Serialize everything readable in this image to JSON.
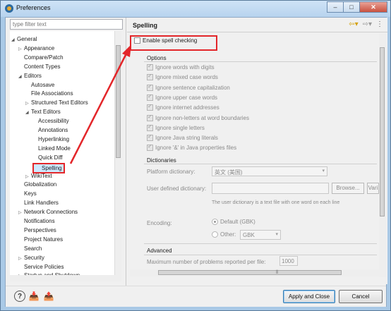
{
  "window": {
    "title": "Preferences"
  },
  "filter": {
    "placeholder": "type filter text"
  },
  "tree": [
    {
      "label": "General",
      "twisty": "open"
    },
    {
      "label": "Appearance",
      "twisty": "closed"
    },
    {
      "label": "Compare/Patch",
      "twisty": ""
    },
    {
      "label": "Content Types",
      "twisty": ""
    },
    {
      "label": "Editors",
      "twisty": "open"
    },
    {
      "label": "Autosave",
      "twisty": ""
    },
    {
      "label": "File Associations",
      "twisty": ""
    },
    {
      "label": "Structured Text Editors",
      "twisty": "closed"
    },
    {
      "label": "Text Editors",
      "twisty": "open"
    },
    {
      "label": "Accessibility",
      "twisty": ""
    },
    {
      "label": "Annotations",
      "twisty": ""
    },
    {
      "label": "Hyperlinking",
      "twisty": ""
    },
    {
      "label": "Linked Mode",
      "twisty": ""
    },
    {
      "label": "Quick Diff",
      "twisty": ""
    },
    {
      "label": "Spelling",
      "twisty": "",
      "selected": true
    },
    {
      "label": "WikiText",
      "twisty": "closed"
    },
    {
      "label": "Globalization",
      "twisty": ""
    },
    {
      "label": "Keys",
      "twisty": ""
    },
    {
      "label": "Link Handlers",
      "twisty": ""
    },
    {
      "label": "Network Connections",
      "twisty": "closed"
    },
    {
      "label": "Notifications",
      "twisty": ""
    },
    {
      "label": "Perspectives",
      "twisty": ""
    },
    {
      "label": "Project Natures",
      "twisty": ""
    },
    {
      "label": "Search",
      "twisty": ""
    },
    {
      "label": "Security",
      "twisty": "closed"
    },
    {
      "label": "Service Policies",
      "twisty": ""
    },
    {
      "label": "Startup and Shutdown",
      "twisty": "closed"
    }
  ],
  "page": {
    "title": "Spelling",
    "enable_spell": {
      "label": "Enable spell checking",
      "checked": false
    },
    "options_label": "Options",
    "options": [
      "Ignore words with digits",
      "Ignore mixed case words",
      "Ignore sentence capitalization",
      "Ignore upper case words",
      "Ignore internet addresses",
      "Ignore non-letters at word boundaries",
      "Ignore single letters",
      "Ignore Java string literals",
      "Ignore '&' in Java properties files"
    ],
    "dictionaries_label": "Dictionaries",
    "platform_dict_label": "Platform dictionary:",
    "platform_dict_value": "英文 (美国)",
    "user_dict_label": "User defined dictionary:",
    "browse_label": "Browse...",
    "variables_label": "Vari",
    "user_dict_note": "The user dictionary is a text file with one word on each line",
    "encoding_label": "Encoding:",
    "encoding_default": "Default (GBK)",
    "encoding_other": "Other:",
    "encoding_other_value": "GBK",
    "advanced_label": "Advanced",
    "max_problems_label": "Maximum number of problems reported per file:",
    "max_problems_value": "1000"
  },
  "buttons": {
    "apply_close": "Apply and Close",
    "cancel": "Cancel"
  },
  "colors": {
    "annotation": "#e3262a",
    "accent": "#3c7fb1"
  }
}
